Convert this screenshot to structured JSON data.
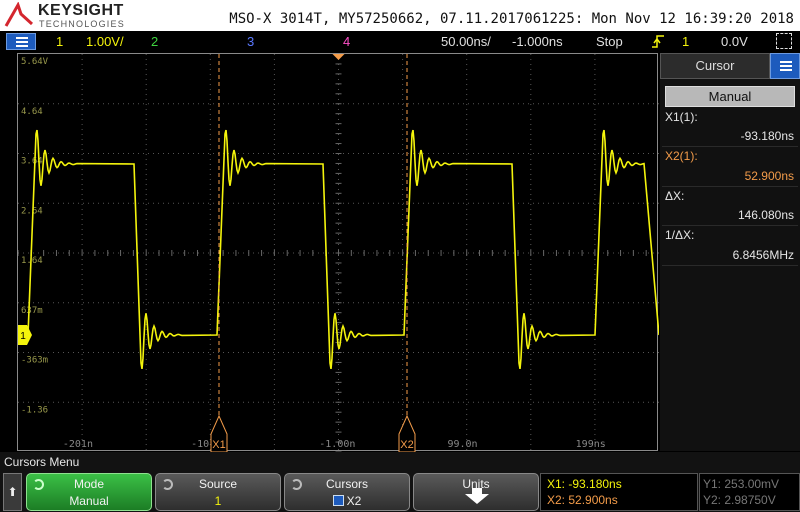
{
  "header": {
    "brand": "KEYSIGHT",
    "brand_sub": "TECHNOLOGIES",
    "instrument_info": "MSO-X 3014T, MY57250662, 07.11.2017061225: Mon Nov 12 16:39:20 2018"
  },
  "status_bar": {
    "ch1_num": "1",
    "ch1_scale": "1.00V/",
    "ch2_num": "2",
    "ch3_num": "3",
    "ch4_num": "4",
    "timebase": "50.00ns/",
    "delay": "-1.000ns",
    "run_state": "Stop",
    "trigger_source": "1",
    "trigger_level": "0.0V",
    "trigger_icon": "trigger-edge-icon"
  },
  "graticule": {
    "y_labels": [
      "5.64V",
      "4.64",
      "3.64",
      "2.64",
      "1.64",
      "637m",
      "-363m",
      "-1.36"
    ],
    "x_labels": [
      "-201n",
      "-10",
      "-1.00n",
      "99.0n",
      "199ns"
    ],
    "cursor_x1_tag": "X1",
    "cursor_x2_tag": "X2",
    "ground_marker": "1"
  },
  "cursor_panel": {
    "title": "Cursor",
    "mode": "Manual",
    "x1_label": "X1(1):",
    "x1_value": "-93.180ns",
    "x2_label": "X2(1):",
    "x2_value": "52.900ns",
    "dx_label": "ΔX:",
    "dx_value": "146.080ns",
    "inv_dx_label": "1/ΔX:",
    "inv_dx_value": "6.8456MHz"
  },
  "bottom": {
    "menu_name": "Cursors Menu",
    "softkeys": [
      {
        "title": "Mode",
        "value": "Manual"
      },
      {
        "title": "Source",
        "value": "1"
      },
      {
        "title": "Cursors",
        "value": "X2"
      },
      {
        "title": "Units",
        "value": ""
      }
    ],
    "readout": {
      "x1": "X1: -93.180ns",
      "x2": "X2: 52.900ns",
      "y1": "Y1: 253.00mV",
      "y2": "Y2: 2.98750V"
    }
  },
  "colors": {
    "ch1": "#f4f40c",
    "ch2": "#3fd43f",
    "ch3": "#5a78ff",
    "ch4": "#ff4fc8",
    "cursor": "#f39c4a"
  }
}
